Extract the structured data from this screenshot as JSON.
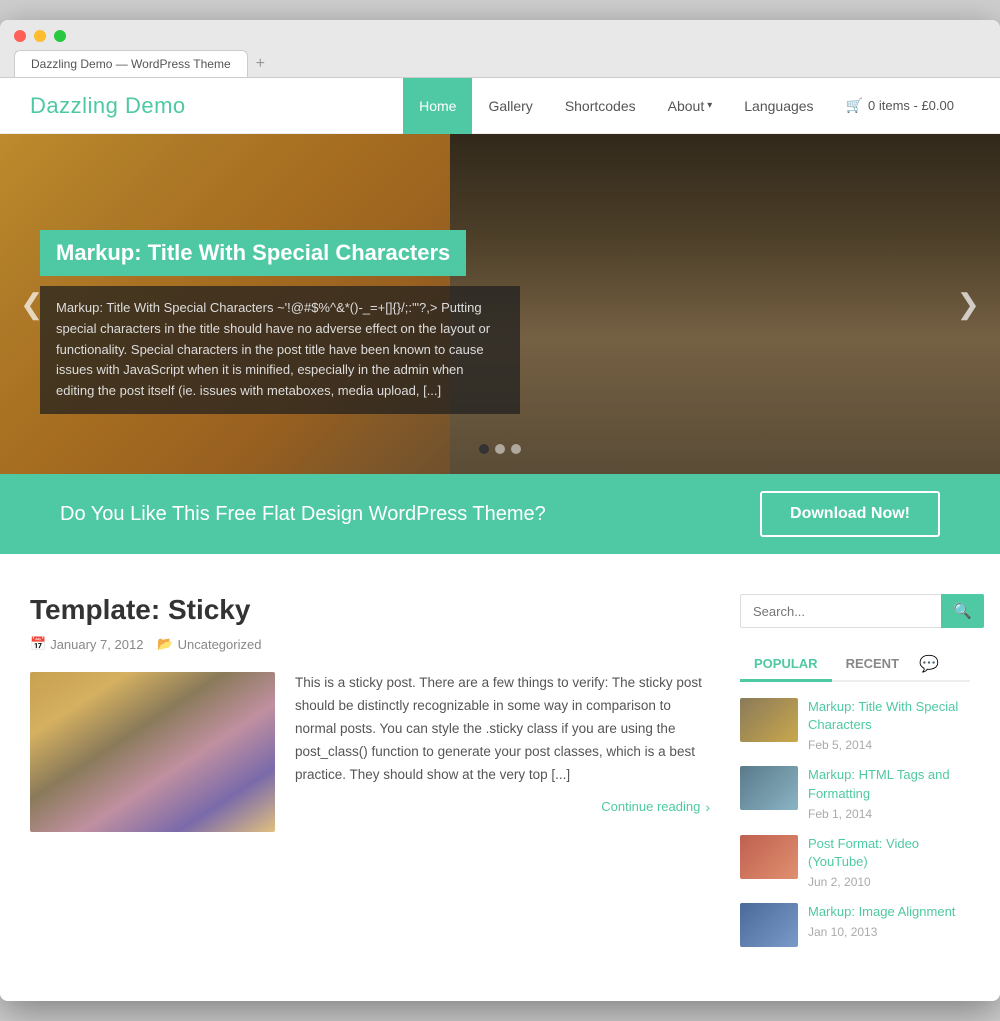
{
  "browser": {
    "tab_label": "Dazzling Demo — WordPress Theme"
  },
  "header": {
    "logo": "Dazzling Demo",
    "nav": [
      {
        "label": "Home",
        "active": true,
        "dropdown": false
      },
      {
        "label": "Gallery",
        "active": false,
        "dropdown": false
      },
      {
        "label": "Shortcodes",
        "active": false,
        "dropdown": false
      },
      {
        "label": "About",
        "active": false,
        "dropdown": true
      },
      {
        "label": "Languages",
        "active": false,
        "dropdown": false
      }
    ],
    "cart": "0 items - £0.00"
  },
  "hero": {
    "title": "Markup: Title With Special Characters",
    "caption": "Markup: Title With Special Characters ~'!@#$%^&*()-_=+[]{}/;:'\"?,> Putting special characters in the title should have no adverse effect on the layout or functionality. Special characters in the post title have been known to cause issues with JavaScript when it is minified, especially in the admin when editing the post itself (ie. issues with metaboxes, media upload, [...]",
    "prev_arrow": "❮",
    "next_arrow": "❯"
  },
  "cta": {
    "text": "Do You Like This Free Flat Design WordPress Theme?",
    "button": "Download Now!"
  },
  "post": {
    "title": "Template: Sticky",
    "date": "January 7, 2012",
    "category": "Uncategorized",
    "excerpt": "This is a sticky post. There are a few things to verify: The sticky post should be distinctly recognizable in some way in comparison to normal posts. You can style the .sticky class if you are using the post_class() function to generate your post classes, which is a best practice. They should show at the very top [...]",
    "continue": "Continue reading"
  },
  "sidebar": {
    "search_placeholder": "Search...",
    "search_button_icon": "🔍",
    "tabs": [
      {
        "label": "POPULAR",
        "active": true
      },
      {
        "label": "RECENT",
        "active": false
      }
    ],
    "posts": [
      {
        "title": "Markup: Title With Special Characters",
        "date": "Feb 5, 2014",
        "thumb_class": "thumb-1"
      },
      {
        "title": "Markup: HTML Tags and Formatting",
        "date": "Feb 1, 2014",
        "thumb_class": "thumb-2"
      },
      {
        "title": "Post Format: Video (YouTube)",
        "date": "Jun 2, 2010",
        "thumb_class": "thumb-3"
      },
      {
        "title": "Markup: Image Alignment",
        "date": "Jan 10, 2013",
        "thumb_class": "thumb-4"
      }
    ]
  }
}
